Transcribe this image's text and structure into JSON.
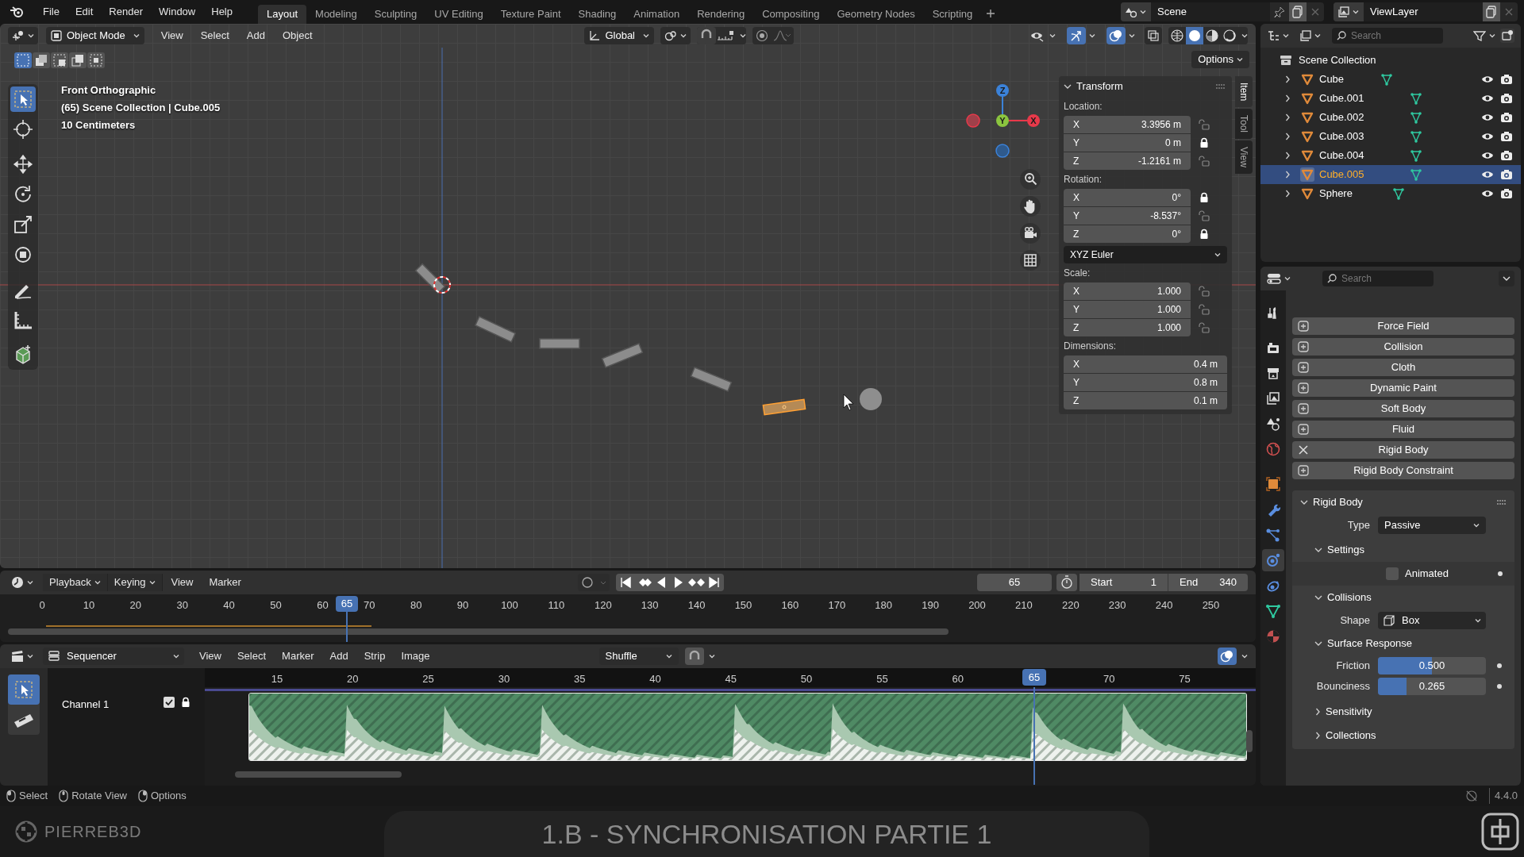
{
  "top_menu": [
    "File",
    "Edit",
    "Render",
    "Window",
    "Help"
  ],
  "workspaces": [
    {
      "label": "Layout",
      "selected": true
    },
    {
      "label": "Modeling",
      "selected": false
    },
    {
      "label": "Sculpting",
      "selected": false
    },
    {
      "label": "UV Editing",
      "selected": false
    },
    {
      "label": "Texture Paint",
      "selected": false
    },
    {
      "label": "Shading",
      "selected": false
    },
    {
      "label": "Animation",
      "selected": false
    },
    {
      "label": "Rendering",
      "selected": false
    },
    {
      "label": "Compositing",
      "selected": false
    },
    {
      "label": "Geometry Nodes",
      "selected": false
    },
    {
      "label": "Scripting",
      "selected": false
    }
  ],
  "scene": {
    "name": "Scene"
  },
  "view_layer": {
    "name": "ViewLayer"
  },
  "viewport": {
    "mode": "Object Mode",
    "menus": [
      "View",
      "Select",
      "Add",
      "Object"
    ],
    "orientation": "Global",
    "options": "Options",
    "overlay_text": [
      "Front Orthographic",
      "(65) Scene Collection | Cube.005",
      "10 Centimeters"
    ],
    "gizmo": [
      {
        "label": "Z",
        "color": "#3b82d9"
      },
      {
        "label": "Y",
        "color": "#8bc53f"
      },
      {
        "label": "X",
        "color": "#e8394a"
      }
    ]
  },
  "sidebar": {
    "tabs": [
      {
        "label": "Item",
        "selected": true
      },
      {
        "label": "Tool",
        "selected": false
      },
      {
        "label": "View",
        "selected": false
      }
    ],
    "title": "Transform",
    "groups": [
      {
        "label": "Location:",
        "fields": [
          {
            "axis": "X",
            "value": "3.3956 m",
            "locked": false
          },
          {
            "axis": "Y",
            "value": "0 m",
            "locked": true
          },
          {
            "axis": "Z",
            "value": "-1.2161 m",
            "locked": false
          }
        ]
      },
      {
        "label": "Rotation:",
        "fields": [
          {
            "axis": "X",
            "value": "0°",
            "locked": true
          },
          {
            "axis": "Y",
            "value": "-8.537°",
            "locked": false
          },
          {
            "axis": "Z",
            "value": "0°",
            "locked": true
          }
        ],
        "mode": "XYZ Euler"
      },
      {
        "label": "Scale:",
        "fields": [
          {
            "axis": "X",
            "value": "1.000",
            "locked": false
          },
          {
            "axis": "Y",
            "value": "1.000",
            "locked": false
          },
          {
            "axis": "Z",
            "value": "1.000",
            "locked": false
          }
        ]
      },
      {
        "label": "Dimensions:",
        "fields": [
          {
            "axis": "X",
            "value": "0.4 m"
          },
          {
            "axis": "Y",
            "value": "0.8 m"
          },
          {
            "axis": "Z",
            "value": "0.1 m"
          }
        ]
      }
    ]
  },
  "outliner": {
    "search_placeholder": "Search",
    "root": "Scene Collection",
    "items": [
      {
        "name": "Cube",
        "selected": false
      },
      {
        "name": "Cube.001",
        "selected": false
      },
      {
        "name": "Cube.002",
        "selected": false
      },
      {
        "name": "Cube.003",
        "selected": false
      },
      {
        "name": "Cube.004",
        "selected": false
      },
      {
        "name": "Cube.005",
        "selected": true
      },
      {
        "name": "Sphere",
        "selected": false
      }
    ]
  },
  "properties": {
    "search_placeholder": "Search",
    "tabs": [
      {
        "kind": "tool",
        "selected": false
      },
      {
        "kind": "render",
        "selected": false
      },
      {
        "kind": "output",
        "selected": false
      },
      {
        "kind": "view_layer",
        "selected": false
      },
      {
        "kind": "scene",
        "selected": false
      },
      {
        "kind": "world",
        "selected": false
      },
      {
        "kind": "object",
        "selected": false
      },
      {
        "kind": "modifiers",
        "selected": false
      },
      {
        "kind": "particles",
        "selected": false
      },
      {
        "kind": "physics",
        "selected": true
      },
      {
        "kind": "constraints",
        "selected": false
      },
      {
        "kind": "data",
        "selected": false
      },
      {
        "kind": "material",
        "selected": false
      }
    ],
    "physics_buttons": [
      {
        "label": "Force Field",
        "enabled": false
      },
      {
        "label": "Collision",
        "enabled": false
      },
      {
        "label": "Cloth",
        "enabled": false
      },
      {
        "label": "Dynamic Paint",
        "enabled": false
      },
      {
        "label": "Soft Body",
        "enabled": false
      },
      {
        "label": "Fluid",
        "enabled": false
      },
      {
        "label": "Rigid Body",
        "enabled": true
      },
      {
        "label": "Rigid Body Constraint",
        "enabled": false
      }
    ],
    "rigid_body": {
      "title": "Rigid Body",
      "type": {
        "label": "Type",
        "value": "Passive"
      },
      "settings": {
        "title": "Settings",
        "expanded": true,
        "animated": {
          "label": "Animated",
          "checked": false
        }
      },
      "collisions": {
        "title": "Collisions",
        "expanded": true,
        "shape": {
          "label": "Shape",
          "value": "Box"
        }
      },
      "surface_response": {
        "title": "Surface Response",
        "expanded": true,
        "sliders": [
          {
            "label": "Friction",
            "value": "0.500",
            "level": 0.5
          },
          {
            "label": "Bounciness",
            "value": "0.265",
            "level": 0.265
          }
        ]
      },
      "sensitivity": {
        "title": "Sensitivity",
        "expanded": false
      },
      "collections": {
        "title": "Collections",
        "expanded": false
      }
    }
  },
  "timeline": {
    "menus": [
      {
        "label": "Playback",
        "dropdown": true
      },
      {
        "label": "Keying",
        "dropdown": true
      },
      {
        "label": "View",
        "dropdown": false
      },
      {
        "label": "Marker",
        "dropdown": false
      }
    ],
    "current_frame": "65",
    "start_label": "Start",
    "start": "1",
    "end_label": "End",
    "end": "340",
    "ruler": [
      "0",
      "10",
      "20",
      "30",
      "40",
      "50",
      "60",
      "70",
      "80",
      "90",
      "100",
      "110",
      "120",
      "130",
      "140",
      "150",
      "160",
      "170",
      "180",
      "190",
      "200",
      "210",
      "220",
      "230",
      "240",
      "250"
    ],
    "playhead": "65"
  },
  "sequencer": {
    "editor": "Sequencer",
    "menus": [
      "View",
      "Select",
      "Marker",
      "Add",
      "Strip",
      "Image"
    ],
    "overlap_mode": "Shuffle",
    "channel": {
      "name": "Channel 1",
      "enabled": true
    },
    "ruler": [
      "15",
      "20",
      "25",
      "30",
      "35",
      "40",
      "45",
      "50",
      "55",
      "60",
      "70",
      "75"
    ],
    "playhead": "65"
  },
  "status_bar": {
    "hints": [
      "Select",
      "Rotate View",
      "Options"
    ],
    "version": "4.4.0"
  },
  "banner": {
    "brand": "PIERREB3D",
    "title": "1.B - SYNCHRONISATION PARTIE 1"
  }
}
